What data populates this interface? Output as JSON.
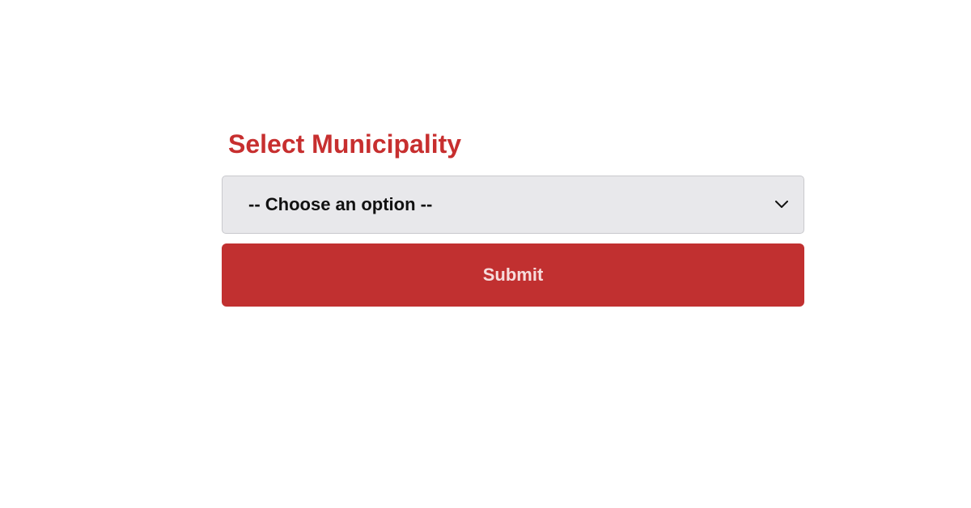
{
  "form": {
    "title": "Select Municipality",
    "select": {
      "selected_label": "-- Choose an option --",
      "options": []
    },
    "submit_label": "Submit"
  },
  "colors": {
    "accent": "#c72f2f",
    "button_bg": "#c13030",
    "select_bg": "#e8e8eb",
    "select_border": "#c9c9cd"
  }
}
